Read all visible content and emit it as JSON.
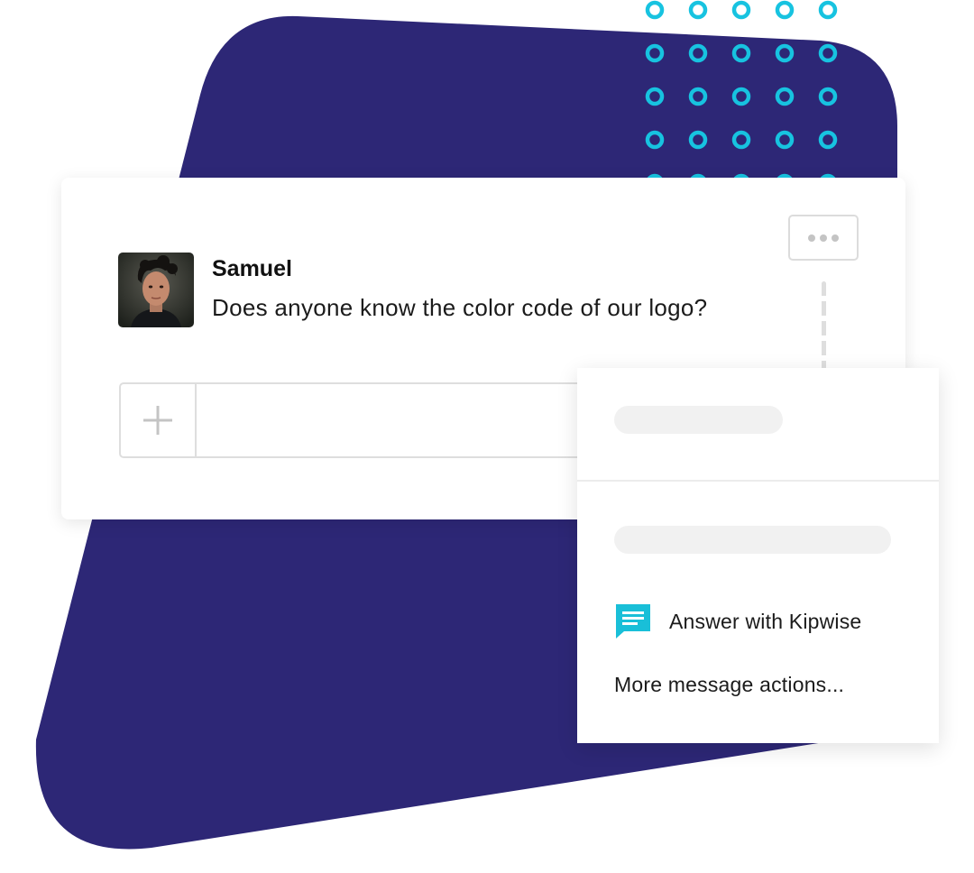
{
  "colors": {
    "background_shape": "#2d2776",
    "dots": "#17c3e0",
    "kipwise_icon": "#19bfd8"
  },
  "message": {
    "sender": "Samuel",
    "text": "Does anyone know the color code of our logo?"
  },
  "composer": {
    "placeholder": "",
    "attach_icon": "plus-icon"
  },
  "message_actions": {
    "trigger_icon": "ellipsis-icon",
    "items": [
      {
        "label": "Answer with Kipwise",
        "icon": "chat-bubble-icon"
      },
      {
        "label": "More message actions..."
      }
    ]
  }
}
